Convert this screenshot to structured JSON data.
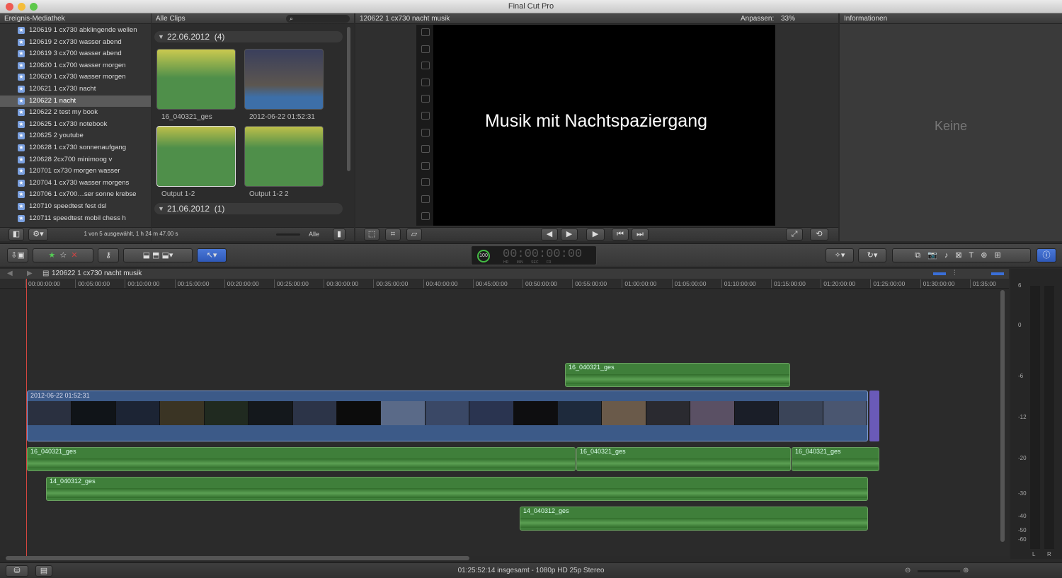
{
  "window": {
    "title": "Final Cut Pro"
  },
  "library": {
    "header": "Ereignis-Mediathek",
    "items": [
      "120619 1 cx730 abklingende wellen",
      "120619 2 cx730 wasser abend",
      "120619 3 cx700 wasser abend",
      "120620 1 cx700 wasser morgen",
      "120620 1 cx730 wasser morgen",
      "120621 1 cx730 nacht",
      "120622 1 nacht",
      "120622 2 test my book",
      "120625 1 cx730 notebook",
      "120625 2 youtube",
      "120628 1 cx730 sonnenaufgang",
      "120628 2cx700 minimoog v",
      "120701 cx730 morgen wasser",
      "120704 1 cx730 wasser morgens",
      "120706 1 cx700…ser sonne krebse",
      "120710 speedtest fest dsl",
      "120711 speedtest mobil chess h"
    ],
    "selected_index": 6
  },
  "browser": {
    "filter": "Alle Clips",
    "status": "1 von 5 ausgewählt, 1 h 24 m 47.00 s",
    "filter_btn": "Alle",
    "groups": [
      {
        "date": "22.06.2012",
        "count": "(4)"
      },
      {
        "date": "21.06.2012",
        "count": "(1)"
      }
    ],
    "clips": [
      "16_040321_ges",
      "2012-06-22 01:52:31",
      "Output 1-2",
      "Output 1-2 2"
    ]
  },
  "viewer": {
    "title": "120622 1 cx730 nacht musik",
    "zoom_label": "Anpassen:",
    "zoom": "33%",
    "overlay_text": "Musik mit Nachtspaziergang"
  },
  "inspector": {
    "header": "Informationen",
    "empty": "Keine"
  },
  "timecode": {
    "value": "100",
    "display": "00:00:00:00",
    "units": [
      "HR",
      "MIN",
      "SEC",
      "FR"
    ]
  },
  "timeline": {
    "project": "120622 1 cx730 nacht musik",
    "ruler": [
      "00:00:00:00",
      "00:05:00:00",
      "00:10:00:00",
      "00:15:00:00",
      "00:20:00:00",
      "00:25:00:00",
      "00:30:00:00",
      "00:35:00:00",
      "00:40:00:00",
      "00:45:00:00",
      "00:50:00:00",
      "00:55:00:00",
      "01:00:00:00",
      "01:05:00:00",
      "01:10:00:00",
      "01:15:00:00",
      "01:20:00:00",
      "01:25:00:00",
      "01:30:00:00",
      "01:35:00"
    ],
    "video_clip": "2012-06-22 01:52:31",
    "audio_clips": [
      "16_040321_ges",
      "16_040321_ges",
      "16_040321_ges",
      "16_040321_ges",
      "14_040312_ges",
      "14_040312_ges"
    ]
  },
  "meter": {
    "scale": [
      "6",
      "0",
      "-6",
      "-12",
      "-20",
      "-30",
      "-40",
      "-50",
      "-60"
    ],
    "channels": [
      "L",
      "R"
    ]
  },
  "status": {
    "text": "01:25:52:14 insgesamt - 1080p HD 25p Stereo"
  },
  "colors": {
    "accent": "#3a6fd8",
    "audio": "#3f7f3a",
    "video": "#3c5a88",
    "playhead": "#d4463f"
  }
}
